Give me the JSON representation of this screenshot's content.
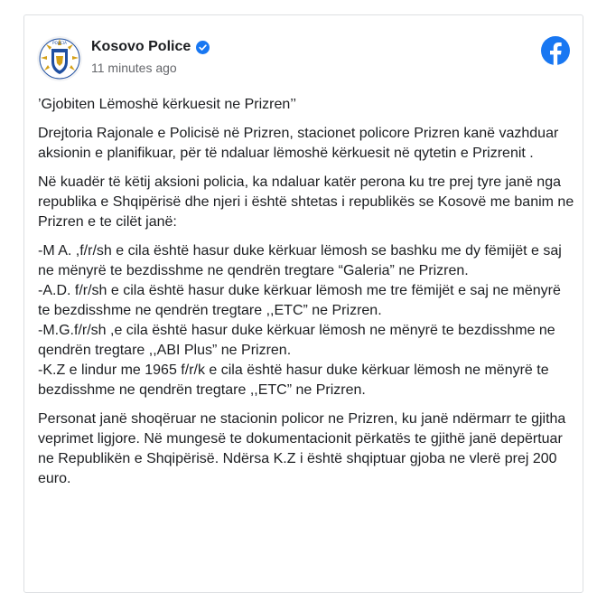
{
  "post": {
    "page_name": "Kosovo Police",
    "timestamp": "11 minutes ago",
    "icons": {
      "avatar": "kosovo-police-logo",
      "verified": "verified-badge-icon",
      "platform": "facebook-logo-icon"
    },
    "colors": {
      "facebook_blue": "#1877f2",
      "text": "#1c1e21",
      "meta": "#65676b"
    },
    "title": "’Gjobiten Lëmoshë kërkuesit ne Prizren’’",
    "paragraph1": "Drejtoria Rajonale e Policisë në Prizren, stacionet policore Prizren kanë vazhduar aksionin e planifikuar, për të ndaluar lëmoshë kërkuesit në qytetin e Prizrenit .",
    "paragraph2": "Në kuadër të këtij aksioni policia, ka ndaluar katër perona ku tre prej tyre janë nga republika e Shqipërisë dhe njeri i është shtetas i republikës se Kosovë me banim ne Prizren e te cilët janë:",
    "items": [
      "-M A. ,f/r/sh e cila është hasur duke kërkuar lëmosh se bashku me dy fëmijët e saj ne mënyrë te bezdisshme ne qendrën tregtare “Galeria” ne Prizren.",
      "-A.D. f/r/sh e cila është hasur duke kërkuar lëmosh me tre fëmijët e saj ne mënyrë te bezdisshme ne qendrën tregtare ,,ETC” ne Prizren.",
      "-M.G.f/r/sh ,e cila është hasur duke kërkuar lëmosh ne mënyrë te bezdisshme ne qendrën tregtare ,,ABI Plus” ne Prizren.",
      "-K.Z e lindur me 1965 f/r/k e cila është hasur duke kërkuar lëmosh ne mënyrë te bezdisshme ne qendrën tregtare ,,ETC” ne Prizren."
    ],
    "paragraph3": "Personat janë shoqëruar ne stacionin policor ne Prizren, ku janë ndërmarr te gjitha veprimet ligjore. Në mungesë te dokumentacionit përkatës te gjithë janë depërtuar ne Republikën e Shqipërisë. Ndërsa K.Z i është shqiptuar gjoba ne vlerë prej 200 euro."
  }
}
